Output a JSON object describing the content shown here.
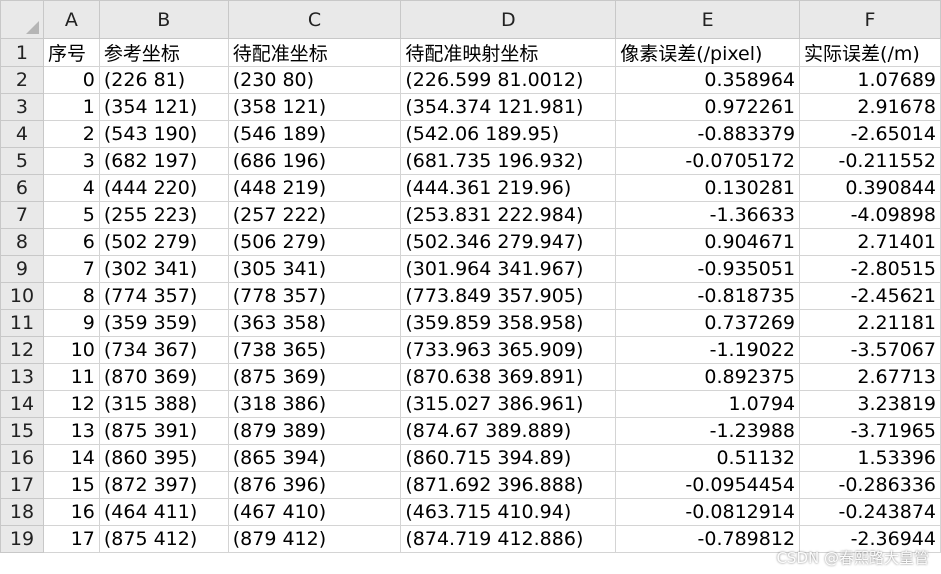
{
  "columns": [
    "A",
    "B",
    "C",
    "D",
    "E",
    "F"
  ],
  "header_row": {
    "row_num": "1",
    "cells": [
      "序号",
      "参考坐标",
      "待配准坐标",
      "待配准映射坐标",
      "像素误差(/pixel)",
      "实际误差(/m)"
    ]
  },
  "rows": [
    {
      "row_num": "2",
      "cells": [
        "0",
        "(226 81)",
        "(230 80)",
        "(226.599 81.0012)",
        "0.358964",
        "1.07689"
      ]
    },
    {
      "row_num": "3",
      "cells": [
        "1",
        "(354 121)",
        "(358 121)",
        "(354.374 121.981)",
        "0.972261",
        "2.91678"
      ]
    },
    {
      "row_num": "4",
      "cells": [
        "2",
        "(543 190)",
        "(546 189)",
        "(542.06 189.95)",
        "-0.883379",
        "-2.65014"
      ]
    },
    {
      "row_num": "5",
      "cells": [
        "3",
        "(682 197)",
        "(686 196)",
        "(681.735 196.932)",
        "-0.0705172",
        "-0.211552"
      ]
    },
    {
      "row_num": "6",
      "cells": [
        "4",
        "(444 220)",
        "(448 219)",
        "(444.361 219.96)",
        "0.130281",
        "0.390844"
      ]
    },
    {
      "row_num": "7",
      "cells": [
        "5",
        "(255 223)",
        "(257 222)",
        "(253.831 222.984)",
        "-1.36633",
        "-4.09898"
      ]
    },
    {
      "row_num": "8",
      "cells": [
        "6",
        "(502 279)",
        "(506 279)",
        "(502.346 279.947)",
        "0.904671",
        "2.71401"
      ]
    },
    {
      "row_num": "9",
      "cells": [
        "7",
        "(302 341)",
        "(305 341)",
        "(301.964 341.967)",
        "-0.935051",
        "-2.80515"
      ]
    },
    {
      "row_num": "10",
      "cells": [
        "8",
        "(774 357)",
        "(778 357)",
        "(773.849 357.905)",
        "-0.818735",
        "-2.45621"
      ]
    },
    {
      "row_num": "11",
      "cells": [
        "9",
        "(359 359)",
        "(363 358)",
        "(359.859 358.958)",
        "0.737269",
        "2.21181"
      ]
    },
    {
      "row_num": "12",
      "cells": [
        "10",
        "(734 367)",
        "(738 365)",
        "(733.963 365.909)",
        "-1.19022",
        "-3.57067"
      ]
    },
    {
      "row_num": "13",
      "cells": [
        "11",
        "(870 369)",
        "(875 369)",
        "(870.638 369.891)",
        "0.892375",
        "2.67713"
      ]
    },
    {
      "row_num": "14",
      "cells": [
        "12",
        "(315 388)",
        "(318 386)",
        "(315.027 386.961)",
        "1.0794",
        "3.23819"
      ]
    },
    {
      "row_num": "15",
      "cells": [
        "13",
        "(875 391)",
        "(879 389)",
        "(874.67 389.889)",
        "-1.23988",
        "-3.71965"
      ]
    },
    {
      "row_num": "16",
      "cells": [
        "14",
        "(860 395)",
        "(865 394)",
        "(860.715 394.89)",
        "0.51132",
        "1.53396"
      ]
    },
    {
      "row_num": "17",
      "cells": [
        "15",
        "(872 397)",
        "(876 396)",
        "(871.692 396.888)",
        "-0.0954454",
        "-0.286336"
      ]
    },
    {
      "row_num": "18",
      "cells": [
        "16",
        "(464 411)",
        "(467 410)",
        "(463.715 410.94)",
        "-0.0812914",
        "-0.243874"
      ]
    },
    {
      "row_num": "19",
      "cells": [
        "17",
        "(875 412)",
        "(879 412)",
        "(874.719 412.886)",
        "-0.789812",
        "-2.36944"
      ]
    }
  ],
  "watermark": "CSDN @春熙路大皇管"
}
